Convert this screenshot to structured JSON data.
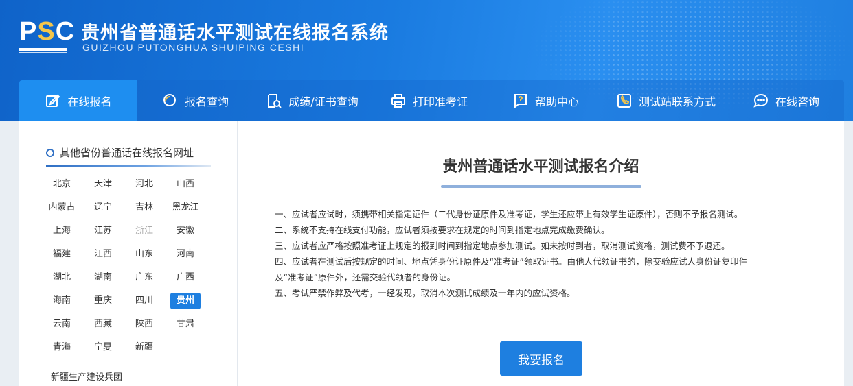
{
  "header": {
    "logo_text": "PSC",
    "title": "贵州省普通话水平测试在线报名系统",
    "subtitle": "GUIZHOU PUTONGHUA SHUIPING CESHI"
  },
  "nav": [
    {
      "label": "在线报名",
      "icon": "edit-icon",
      "active": true
    },
    {
      "label": "报名查询",
      "icon": "search-icon",
      "active": false
    },
    {
      "label": "成绩/证书查询",
      "icon": "document-search-icon",
      "active": false
    },
    {
      "label": "打印准考证",
      "icon": "printer-icon",
      "active": false
    },
    {
      "label": "帮助中心",
      "icon": "help-icon",
      "active": false
    },
    {
      "label": "测试站联系方式",
      "icon": "phone-icon",
      "active": false
    },
    {
      "label": "在线咨询",
      "icon": "chat-icon",
      "active": false
    }
  ],
  "sidebar": {
    "title": "其他省份普通话在线报名网址",
    "provinces": [
      "北京",
      "天津",
      "河北",
      "山西",
      "内蒙古",
      "辽宁",
      "吉林",
      "黑龙江",
      "上海",
      "江苏",
      "浙江",
      "安徽",
      "福建",
      "江西",
      "山东",
      "河南",
      "湖北",
      "湖南",
      "广东",
      "广西",
      "海南",
      "重庆",
      "四川",
      "贵州",
      "云南",
      "西藏",
      "陕西",
      "甘肃",
      "青海",
      "宁夏",
      "新疆"
    ],
    "gray_province": "浙江",
    "active_province": "贵州",
    "extra": "新疆生产建设兵团"
  },
  "main": {
    "title": "贵州普通话水平测试报名介绍",
    "notes": [
      "一、应试者应试时，须携带相关指定证件（二代身份证原件及准考证，学生还应带上有效学生证原件），否则不予报名测试。",
      "二、系统不支持在线支付功能，应试者须按要求在规定的时间到指定地点完成缴费确认。",
      "三、应试者应严格按照准考证上规定的报到时间到指定地点参加测试。如未按时到者，取消测试资格，测试费不予退还。",
      "四、应试者在测试后按规定的时间、地点凭身份证原件及“准考证”领取证书。由他人代领证书的，除交验应试人身份证复印件",
      "及“准考证”原件外，还需交验代领者的身份证。",
      "五、考试严禁作弊及代考，一经发现，取消本次测试成绩及一年内的应试资格。"
    ],
    "apply_button": "我要报名"
  },
  "colors": {
    "brand": "#1e7fe0",
    "header": "#1a7be0"
  }
}
